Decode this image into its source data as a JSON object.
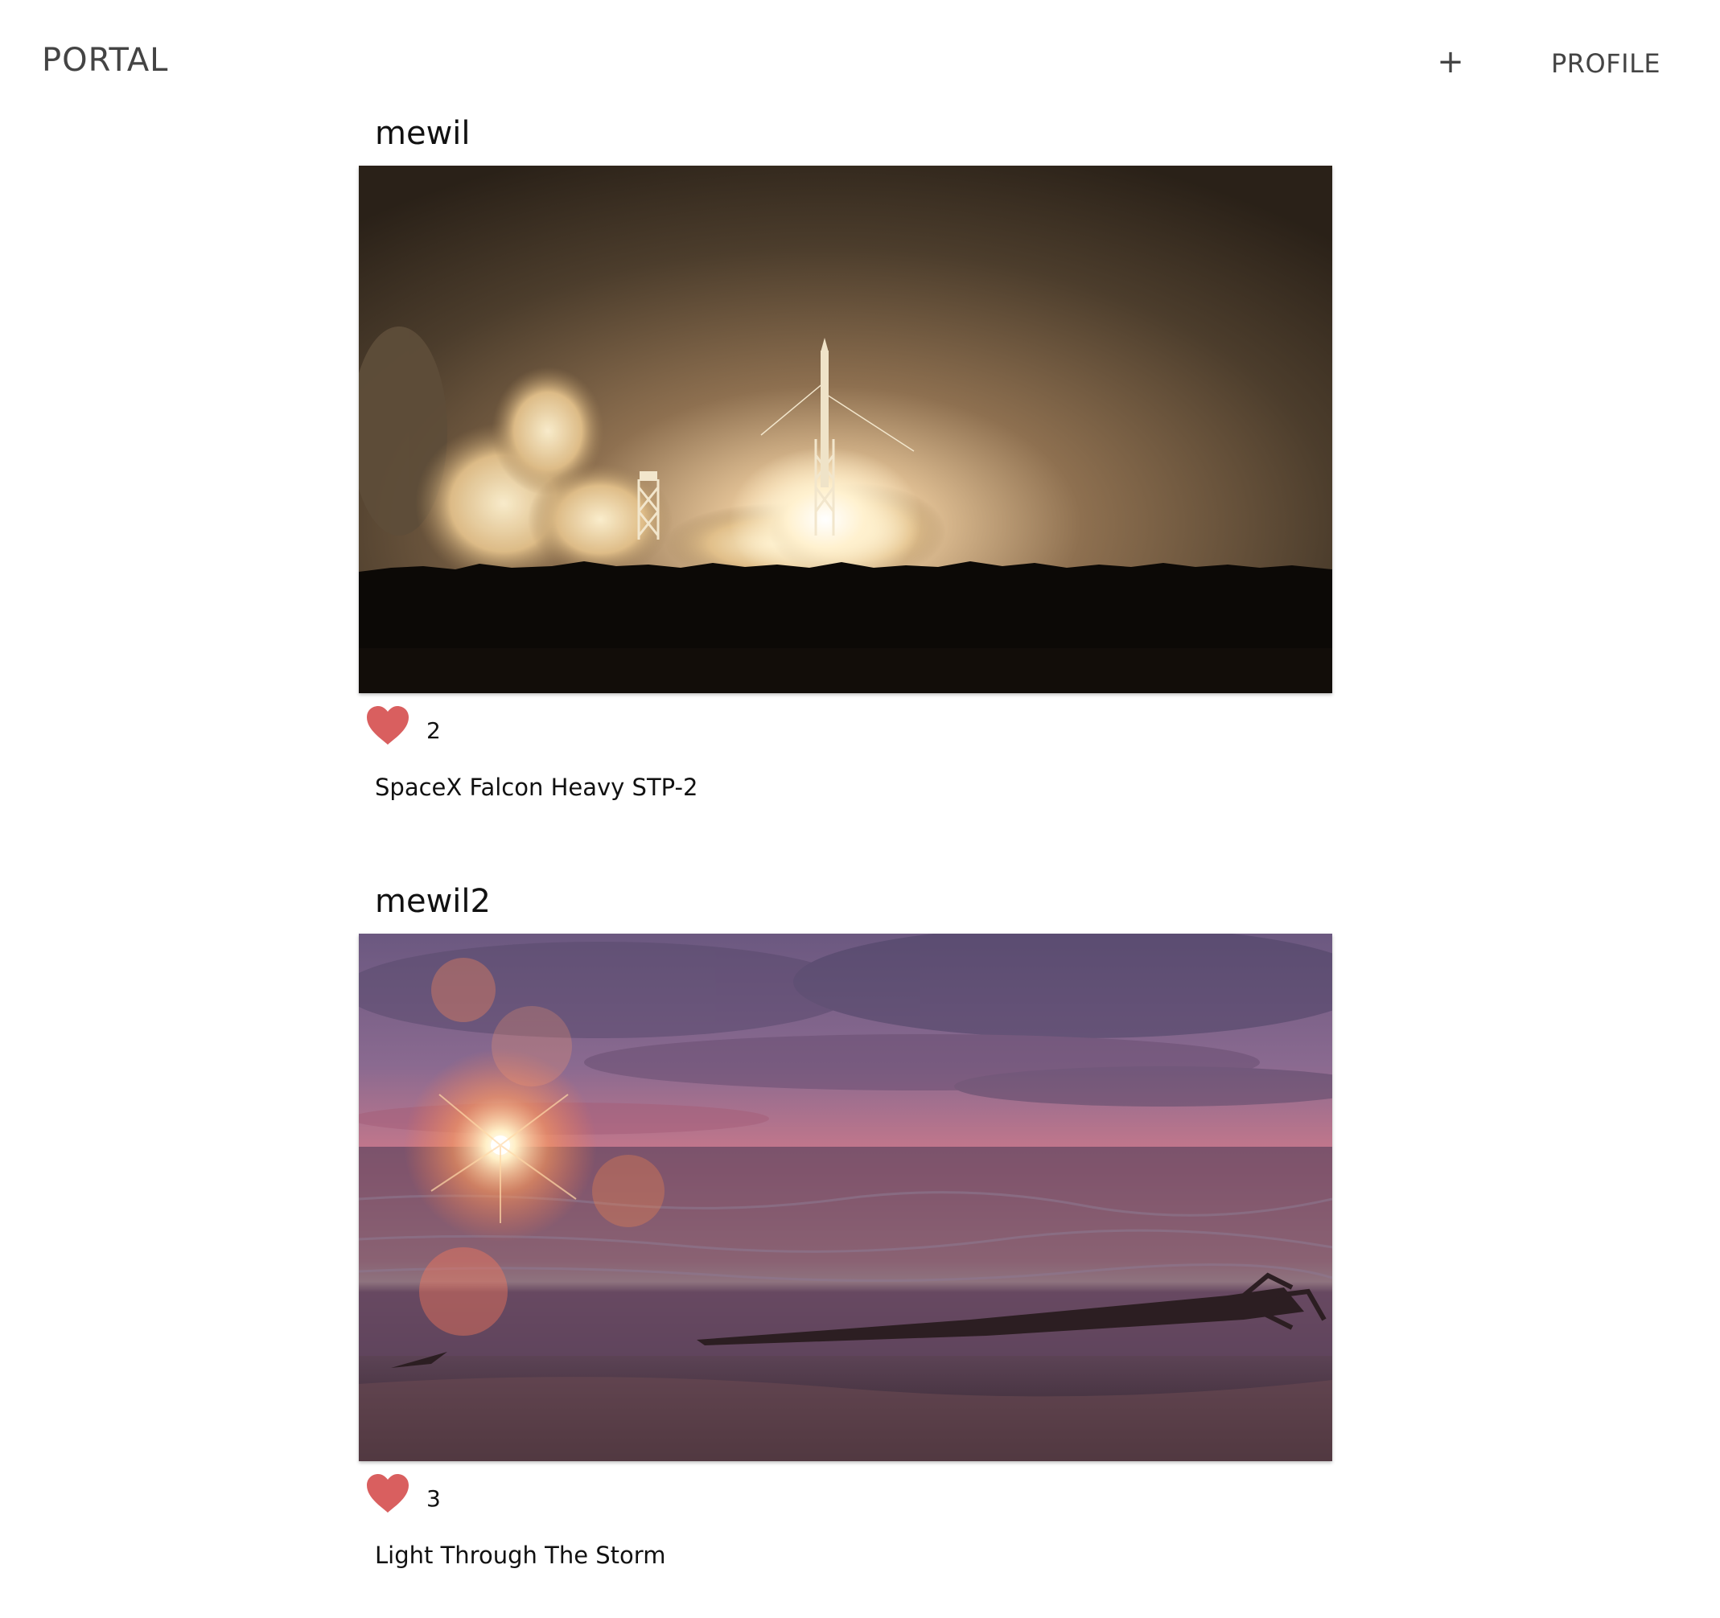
{
  "nav": {
    "brand": "PORTAL",
    "add_label": "+",
    "profile_label": "PROFILE"
  },
  "posts": [
    {
      "username": "mewil",
      "likes": "2",
      "caption": "SpaceX Falcon Heavy STP-2"
    },
    {
      "username": "mewil2",
      "likes": "3",
      "caption": "Light Through The Storm"
    }
  ],
  "colors": {
    "heart": "#d95f5f",
    "nav_text": "#444444",
    "background": "#ffffff"
  },
  "icons": {
    "like": "heart-icon"
  }
}
